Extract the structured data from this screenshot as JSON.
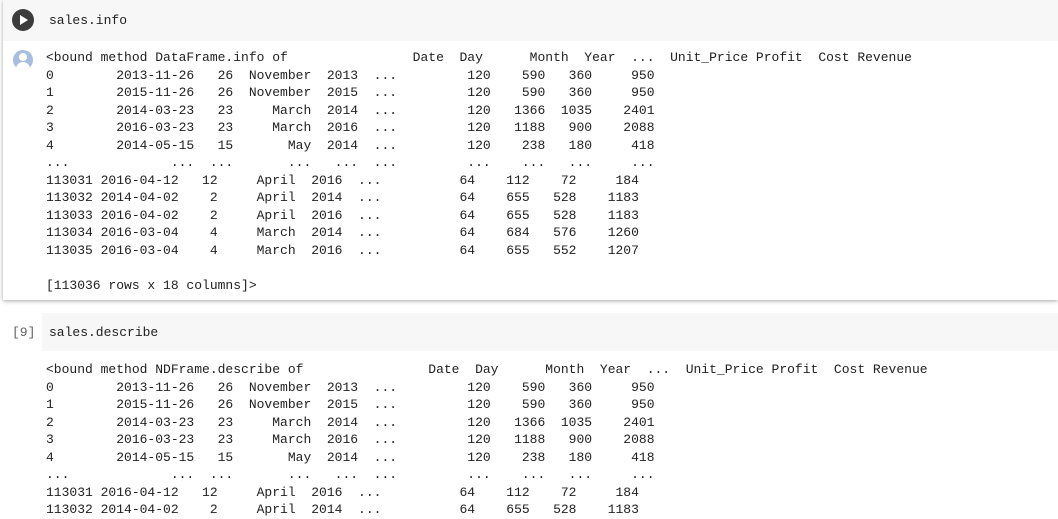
{
  "cell1": {
    "code": "sales.info",
    "output_lines": [
      "<bound method DataFrame.info of                Date  Day      Month  Year  ...  Unit_Price Profit  Cost Revenue",
      "0        2013-11-26   26  November  2013  ...         120    590   360     950",
      "1        2015-11-26   26  November  2015  ...         120    590   360     950",
      "2        2014-03-23   23     March  2014  ...         120   1366  1035    2401",
      "3        2016-03-23   23     March  2016  ...         120   1188   900    2088",
      "4        2014-05-15   15       May  2014  ...         120    238   180     418",
      "...             ...  ...       ...   ...  ...         ...    ...   ...     ...",
      "113031 2016-04-12   12     April  2016  ...          64    112    72     184",
      "113032 2014-04-02    2     April  2014  ...          64    655   528    1183",
      "113033 2016-04-02    2     April  2016  ...          64    655   528    1183",
      "113034 2016-03-04    4     March  2014  ...          64    684   576    1260",
      "113035 2016-03-04    4     March  2016  ...          64    655   552    1207"
    ],
    "output_tail": "[113036 rows x 18 columns]>"
  },
  "cell2": {
    "prompt": "[9]",
    "code": "sales.describe",
    "output_lines": [
      "<bound method NDFrame.describe of                Date  Day      Month  Year  ...  Unit_Price Profit  Cost Revenue",
      "0        2013-11-26   26  November  2013  ...         120    590   360     950",
      "1        2015-11-26   26  November  2015  ...         120    590   360     950",
      "2        2014-03-23   23     March  2014  ...         120   1366  1035    2401",
      "3        2016-03-23   23     March  2016  ...         120   1188   900    2088",
      "4        2014-05-15   15       May  2014  ...         120    238   180     418",
      "...             ...  ...       ...   ...  ...         ...    ...   ...     ...",
      "113031 2016-04-12   12     April  2016  ...          64    112    72     184",
      "113032 2014-04-02    2     April  2014  ...          64    655   528    1183"
    ]
  }
}
